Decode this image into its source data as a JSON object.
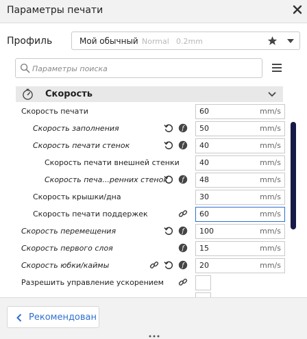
{
  "window": {
    "title": "Параметры печати"
  },
  "profile": {
    "label": "Профиль",
    "name": "Мой обычный",
    "quality": "Normal",
    "layer": "0.2mm"
  },
  "search": {
    "placeholder": "Параметры поиска",
    "value": ""
  },
  "section": {
    "title": "Скорость"
  },
  "settings": [
    {
      "label": "Скорость печати",
      "value": "60",
      "unit": "mm/s"
    },
    {
      "label": "Скорость заполнения",
      "value": "50",
      "unit": "mm/s"
    },
    {
      "label": "Скорость печати стенок",
      "value": "40",
      "unit": "mm/s"
    },
    {
      "label": "Скорость печати внешней стенки",
      "value": "40",
      "unit": "mm/s"
    },
    {
      "label": "Скорость печа...ренних стенок",
      "value": "48",
      "unit": "mm/s"
    },
    {
      "label": "Скорость крышки/дна",
      "value": "30",
      "unit": "mm/s"
    },
    {
      "label": "Скорость печати поддержек",
      "value": "60",
      "unit": "mm/s"
    },
    {
      "label": "Скорость перемещения",
      "value": "100",
      "unit": "mm/s"
    },
    {
      "label": "Скорость первого слоя",
      "value": "15",
      "unit": "mm/s"
    },
    {
      "label": "Скорость юбки/каймы",
      "value": "20",
      "unit": "mm/s"
    },
    {
      "label": "Разрешить управление ускорением",
      "checked": false
    }
  ],
  "footer": {
    "back_label": "Рекомендован"
  },
  "colors": {
    "accent": "#2f6fd1",
    "scrollbar": "#171a47",
    "header_bg": "#e8e8e8"
  },
  "icons": [
    "close-icon",
    "star-icon",
    "chevron-down-icon",
    "search-icon",
    "menu-icon",
    "gauge-icon",
    "reset-icon",
    "calculator-icon",
    "link-icon",
    "chevron-left-icon"
  ]
}
